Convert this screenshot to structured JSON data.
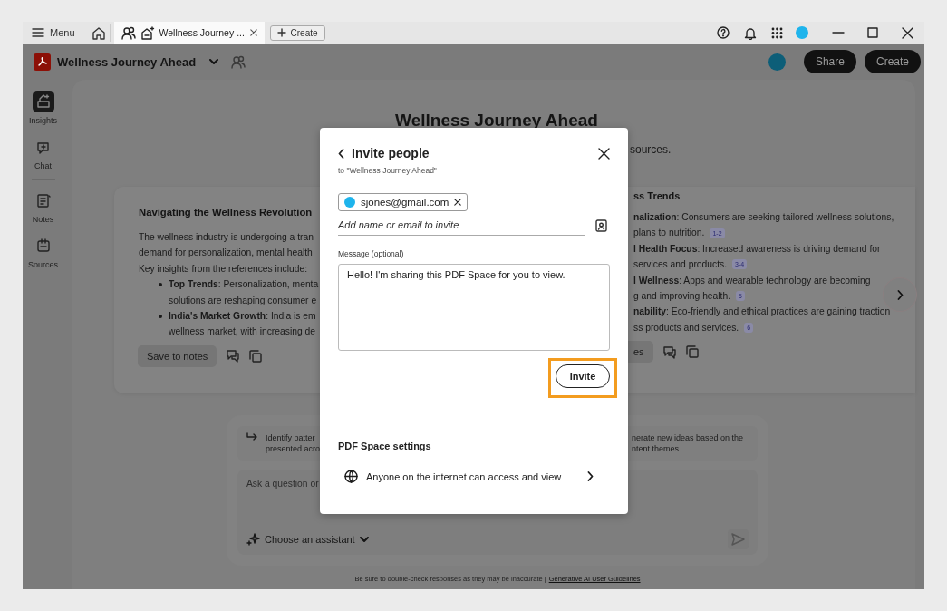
{
  "titlebar": {
    "menu": "Menu",
    "tab": {
      "title": "Wellness Journey ...",
      "selected": true
    },
    "create": "Create"
  },
  "header": {
    "title": "Wellness Journey Ahead",
    "share": "Share",
    "create": "Create"
  },
  "rail": [
    {
      "label": "Insights",
      "selected": true
    },
    {
      "label": "Chat",
      "selected": false
    },
    {
      "label": "Notes",
      "selected": false
    },
    {
      "label": "Sources",
      "selected": false
    }
  ],
  "page": {
    "title": "Wellness Journey Ahead",
    "subtitle": "sources."
  },
  "cards": [
    {
      "title": "Navigating the Wellness Revolution",
      "lines": [
        {
          "kind": "para",
          "text": "The wellness industry is undergoing a tran"
        },
        {
          "kind": "para",
          "text": "demand for personalization, mental health"
        },
        {
          "kind": "para",
          "text": "Key insights from the references include:"
        },
        {
          "kind": "bullet",
          "text": "**Top Trends**: Personalization, menta"
        },
        {
          "kind": "cont",
          "text": "solutions are reshaping consumer e"
        },
        {
          "kind": "bullet",
          "text": "**India's Market Growth**: India is em"
        },
        {
          "kind": "cont",
          "text": "wellness market, with increasing de"
        }
      ],
      "save": "Save to notes"
    },
    {
      "title": "ss Trends",
      "lines": [
        {
          "kind": "para",
          "text": "**nalization**: Consumers are seeking tailored wellness solutions,"
        },
        {
          "kind": "para",
          "text": "plans to nutrition.",
          "ref": "1-2"
        },
        {
          "kind": "para",
          "text": "**l Health Focus**: Increased awareness is driving demand for"
        },
        {
          "kind": "para",
          "text": "services and products.",
          "ref": "3-4"
        },
        {
          "kind": "para",
          "text": "**l Wellness**: Apps and wearable technology are becoming"
        },
        {
          "kind": "para",
          "text": "g and improving health.",
          "ref": "5"
        },
        {
          "kind": "para",
          "text": "**nability**: Eco-friendly and ethical practices are gaining traction"
        },
        {
          "kind": "para",
          "text": "ss products and services.",
          "ref": "6"
        }
      ],
      "save": "es"
    }
  ],
  "prompt": {
    "suggestions": [
      {
        "lines": [
          "Identify patter",
          "presented acro"
        ]
      },
      {
        "lines": [
          "nerate new ideas based on the",
          "ntent themes"
        ]
      }
    ],
    "placeholder": "Ask a question or",
    "assistant": "Choose an assistant"
  },
  "footer": {
    "note": "Be sure to double-check responses as they may be inaccurate |",
    "link": "Generative AI User Guidelines"
  },
  "dialog": {
    "title": "Invite people",
    "subtitle": "to \"Wellness Journey Ahead\"",
    "chips": [
      {
        "email": "sjones@gmail.com"
      }
    ],
    "placeholder": "Add name or email to invite",
    "message_label": "Message (optional)",
    "message": "Hello! I'm sharing this PDF Space for you to view.",
    "invite": "Invite",
    "settings_title": "PDF Space settings",
    "access": "Anyone on the internet can access and view"
  }
}
